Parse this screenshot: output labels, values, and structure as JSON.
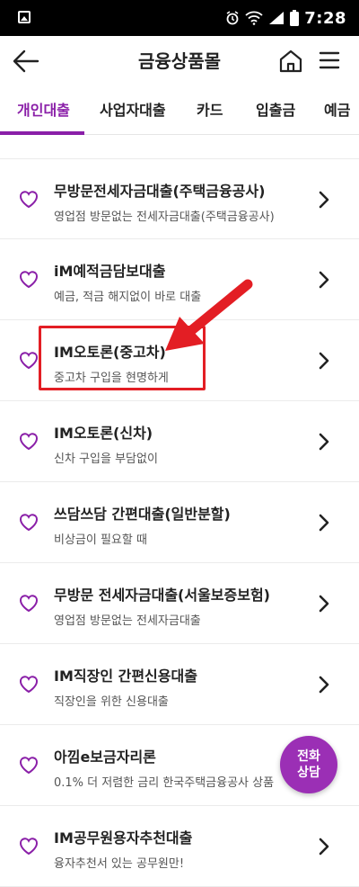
{
  "status_bar": {
    "time": "7:28"
  },
  "header": {
    "title": "금융상품몰"
  },
  "tabs": [
    {
      "label": "개인대출",
      "active": true
    },
    {
      "label": "사업자대출"
    },
    {
      "label": "카드"
    },
    {
      "label": "입출금"
    },
    {
      "label": "예금"
    }
  ],
  "products": [
    {
      "title": "무방문전세자금대출(주택금융공사)",
      "subtitle": "영업점 방문없는 전세자금대출(주택금융공사)"
    },
    {
      "title": "iM예적금담보대출",
      "subtitle": "예금, 적금 해지없이 바로 대출"
    },
    {
      "title": "IM오토론(중고차)",
      "subtitle": "중고차 구입을 현명하게",
      "highlighted": true
    },
    {
      "title": "IM오토론(신차)",
      "subtitle": "신차 구입을 부담없이"
    },
    {
      "title": "쓰담쓰담 간편대출(일반분할)",
      "subtitle": "비상금이 필요할 때"
    },
    {
      "title": "무방문 전세자금대출(서울보증보험)",
      "subtitle": "영업점 방문없는 전세자금대출"
    },
    {
      "title": "IM직장인 간편신용대출",
      "subtitle": "직장인을 위한 신용대출"
    },
    {
      "title": "아낌e보금자리론",
      "subtitle": "0.1% 더 저렴한 금리 한국주택금융공사 상품"
    },
    {
      "title": "IM공무원용자추천대출",
      "subtitle": "융자추천서 있는 공무원만!"
    }
  ],
  "fab": {
    "line1": "전화",
    "line2": "상담"
  },
  "colors": {
    "accent": "#8a1fa8",
    "highlight": "#e31e24",
    "fab": "#9b2fb5"
  }
}
